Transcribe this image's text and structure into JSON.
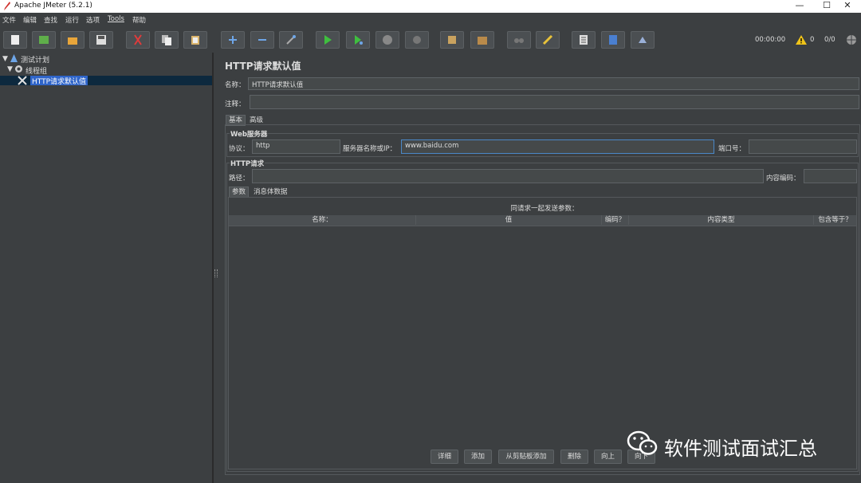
{
  "window": {
    "title": "Apache JMeter (5.2.1)",
    "minimize": "—",
    "maximize": "☐",
    "close": "✕"
  },
  "menu": [
    "文件",
    "编辑",
    "查找",
    "运行",
    "选项",
    "Tools",
    "帮助"
  ],
  "toolbar": {
    "icons": [
      "new-icon",
      "templates-icon",
      "open-icon",
      "save-icon",
      "cut-icon",
      "copy-icon",
      "paste-icon",
      "expand-icon",
      "collapse-icon",
      "toggle-icon",
      "start-icon",
      "start-no-pause-icon",
      "stop-icon",
      "shutdown-icon",
      "clear-icon",
      "clear-all-icon",
      "search-icon",
      "reset-search-icon",
      "function-helper-icon",
      "help-icon",
      "remote-icon"
    ],
    "clock": "00:00:00",
    "warn_count": "0",
    "threads_ratio": "0/0"
  },
  "tree": {
    "root": "测试计划",
    "group": "线程组",
    "selected": "HTTP请求默认值"
  },
  "panel": {
    "title": "HTTP请求默认值",
    "name_label": "名称：",
    "name_value": "HTTP请求默认值",
    "comment_label": "注释：",
    "comment_value": "",
    "tabs": [
      "基本",
      "高级"
    ],
    "web_server": {
      "title": "Web服务器",
      "protocol_label": "协议：",
      "protocol_value": "http",
      "server_label": "服务器名称或IP：",
      "server_value": "www.baidu.com",
      "port_label": "端口号：",
      "port_value": ""
    },
    "http_request": {
      "title": "HTTP请求",
      "path_label": "路径：",
      "path_value": "",
      "encoding_label": "内容编码：",
      "encoding_value": ""
    },
    "subtabs": [
      "参数",
      "消息体数据"
    ],
    "params_caption": "同请求一起发送参数：",
    "columns": [
      "名称：",
      "值",
      "编码？",
      "内容类型",
      "包含等于？"
    ],
    "buttons": [
      "详细",
      "添加",
      "从剪贴板添加",
      "删除",
      "向上",
      "向下"
    ]
  },
  "watermark": "软件测试面试汇总"
}
